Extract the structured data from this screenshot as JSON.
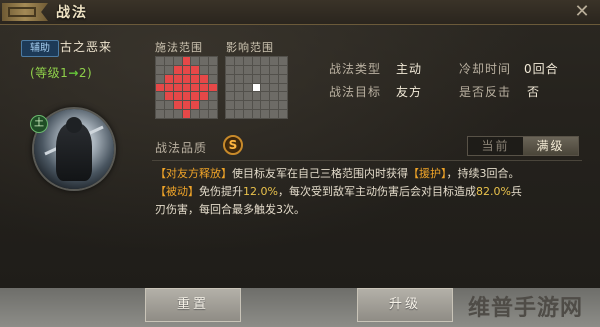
{
  "window": {
    "title": "战法",
    "close_label": "✕"
  },
  "general": {
    "role_badge": "辅助",
    "name": "古之恶来",
    "level_prefix": "(等级1",
    "level_arrow": "→",
    "level_suffix": "2)",
    "portrait_tag": "土"
  },
  "ranges": {
    "cast_label": "施法范围",
    "effect_label": "影响范围"
  },
  "stats": {
    "type_label": "战法类型",
    "type_value": "主动",
    "target_label": "战法目标",
    "target_value": "友方",
    "cooldown_label": "冷却时间",
    "cooldown_value": "0回合",
    "counter_label": "是否反击",
    "counter_value": "否"
  },
  "quality": {
    "label": "战法品质",
    "grade": "S",
    "toggle_current": "当前",
    "toggle_max": "满级"
  },
  "description": {
    "line1_tag": "【对友方释放】",
    "line1_a": "使目标友军在自己三格范围内时获得",
    "line1_hl": "【援护】",
    "line1_b": "，持续3回合。",
    "line2_tag": "【被动】",
    "line2_a": "免伤提升",
    "line2_hl1": "12.0%",
    "line2_b": "，每次受到敌军主动伤害后会对目标造成",
    "line2_hl2": "82.0%",
    "line2_c": "兵",
    "line3": "刃伤害，每回合最多触发3次。"
  },
  "buttons": {
    "reset": "重置",
    "upgrade": "升级"
  },
  "watermark": "维普手游网",
  "colors": {
    "accent_gold": "#f0a428",
    "range_red": "#e64848",
    "level_green": "#8fd04a"
  }
}
